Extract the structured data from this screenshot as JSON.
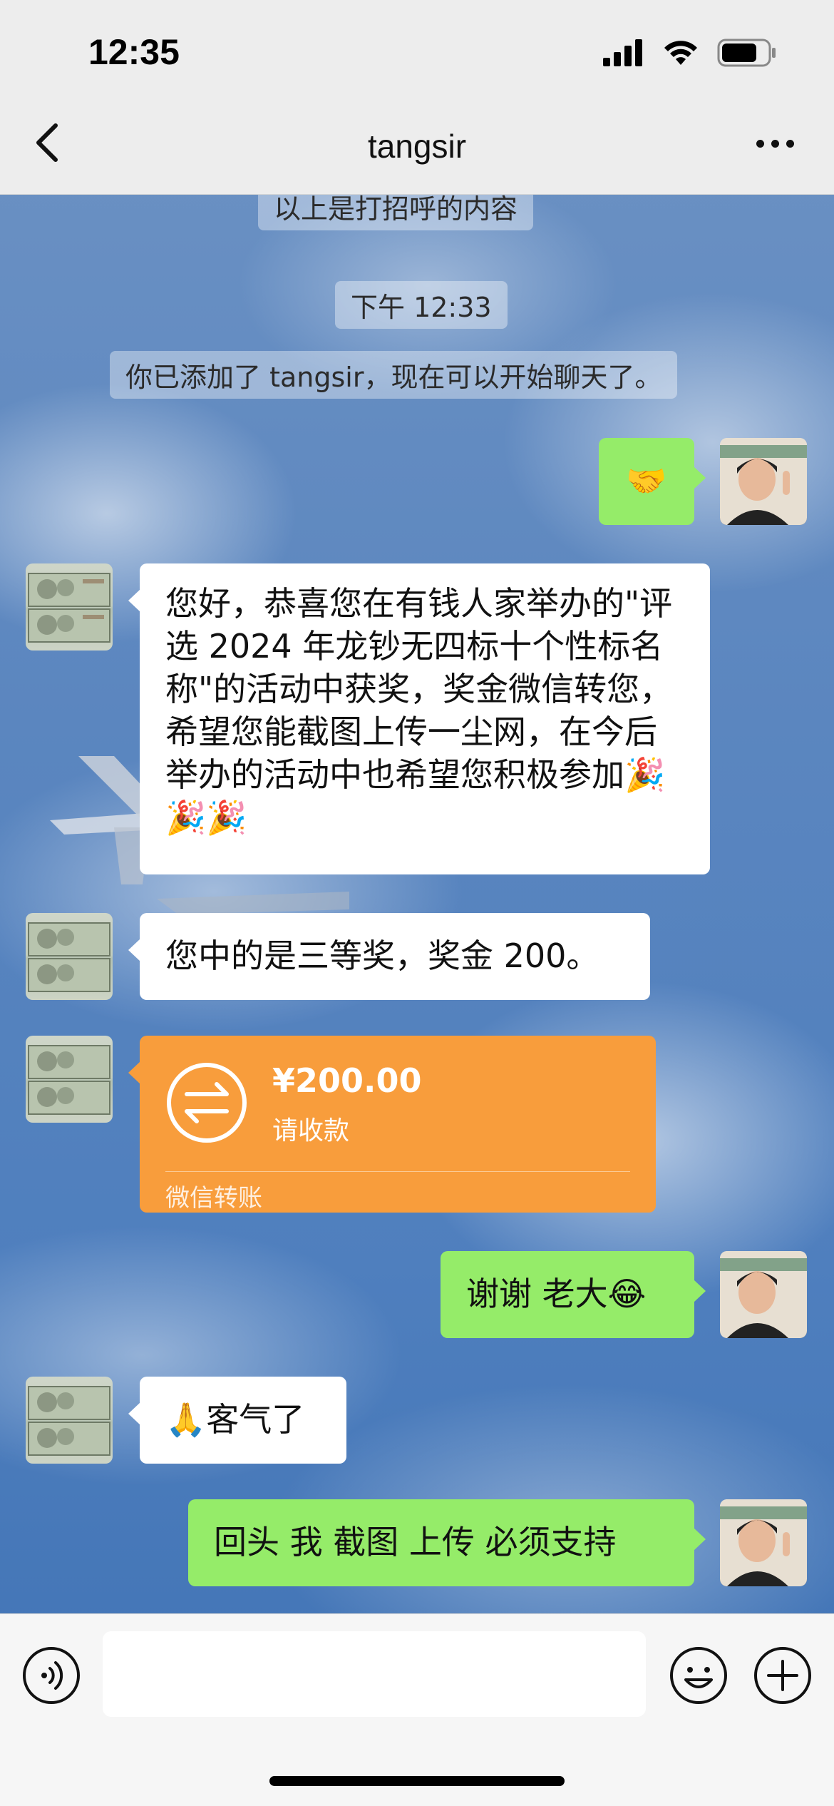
{
  "status_bar": {
    "time": "12:35"
  },
  "nav": {
    "title": "tangsir"
  },
  "system": {
    "greeting_note": "以上是打招呼的内容",
    "timestamp": "下午 12:33",
    "added_notice": "你已添加了 tangsir，现在可以开始聊天了。"
  },
  "messages": [
    {
      "sender": "self",
      "text": "🤝"
    },
    {
      "sender": "contact",
      "text": "您好，恭喜您在有钱人家举办的\"评选 2024 年龙钞无四标十个性标名称\"的活动中获奖，奖金微信转您，希望您能截图上传一尘网，在今后举办的活动中也希望您积极参加🎉🎉🎉"
    },
    {
      "sender": "contact",
      "text": "您中的是三等奖，奖金 200。"
    },
    {
      "sender": "self",
      "text": "谢谢 老大😂"
    },
    {
      "sender": "contact",
      "text": "🙏客气了"
    },
    {
      "sender": "self",
      "text": "回头 我 截图 上传  必须支持"
    }
  ],
  "transfer": {
    "amount": "¥200.00",
    "status": "请收款",
    "source": "微信转账"
  },
  "colors": {
    "self_bubble": "#95ec69",
    "contact_bubble": "#ffffff",
    "transfer_card": "#f89d3c",
    "top_bar": "#ededed"
  },
  "icons": {
    "back": "chevron-left-icon",
    "more": "more-dots-icon",
    "voice": "voice-icon",
    "emoji": "emoji-icon",
    "plus": "plus-icon",
    "transfer": "transfer-arrows-icon"
  }
}
